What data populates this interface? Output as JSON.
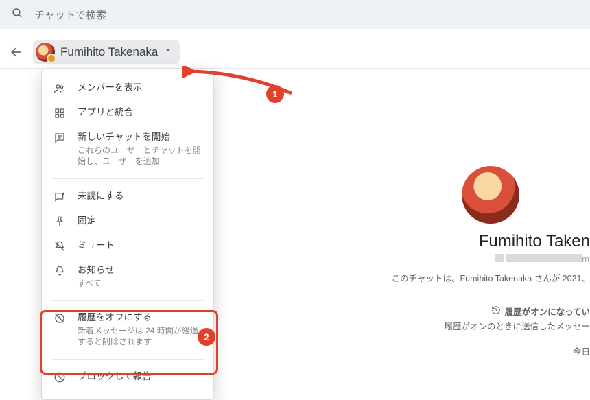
{
  "search": {
    "placeholder": "チャットで検索"
  },
  "header": {
    "name": "Fumihito Takenaka"
  },
  "menu": {
    "members": "メンバーを表示",
    "apps": "アプリと統合",
    "newchat": {
      "title": "新しいチャットを開始",
      "sub": "これらのユーザーとチャットを開始し、ユーザーを追加"
    },
    "unread": "未読にする",
    "pin": "固定",
    "mute": "ミュート",
    "notify": {
      "title": "お知らせ",
      "sub": "すべて"
    },
    "historyoff": {
      "title": "履歴をオフにする",
      "sub": "新着メッセージは 24 時間が経過すると削除されます"
    },
    "block": "ブロックして報告"
  },
  "annot": {
    "one": "1",
    "two": "2"
  },
  "right": {
    "name": "Fumihito Taken",
    "email_tail": "m",
    "desc": "このチャットは、Fumihito Takenaka さんが 2021、",
    "history_on": "履歴がオンになってい",
    "history_sub": "履歴がオンのときに送信したメッセー",
    "today": "今日"
  }
}
